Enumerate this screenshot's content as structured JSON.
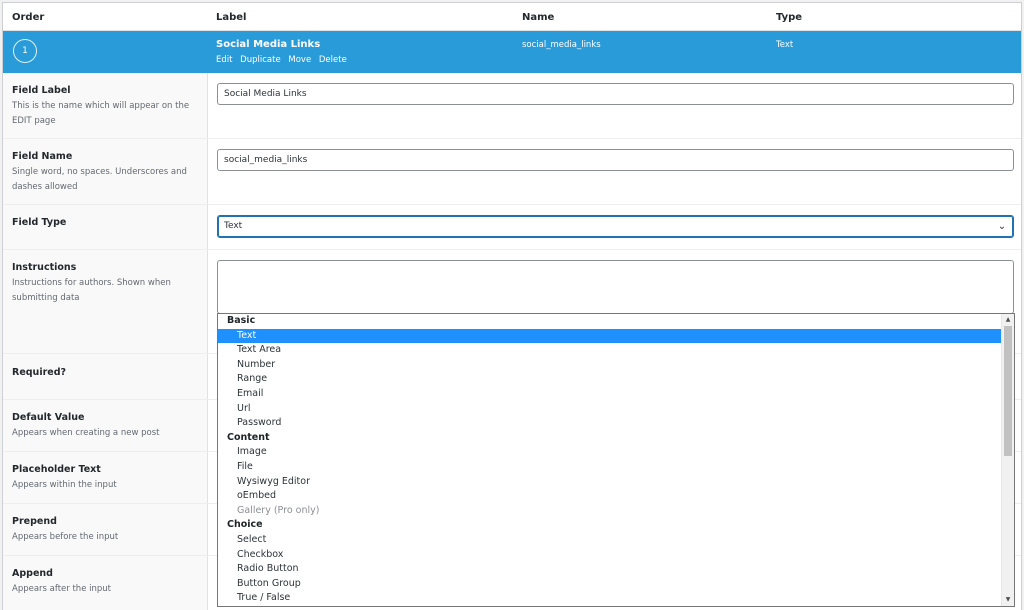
{
  "table_header": {
    "order": "Order",
    "label": "Label",
    "name": "Name",
    "type": "Type"
  },
  "field_row": {
    "order": "1",
    "label": "Social Media Links",
    "actions": [
      "Edit",
      "Duplicate",
      "Move",
      "Delete"
    ],
    "name": "social_media_links",
    "type": "Text"
  },
  "settings": {
    "field_label": {
      "title": "Field Label",
      "desc": "This is the name which will appear on the EDIT page",
      "value": "Social Media Links"
    },
    "field_name": {
      "title": "Field Name",
      "desc": "Single word, no spaces. Underscores and dashes allowed",
      "value": "social_media_links"
    },
    "field_type": {
      "title": "Field Type",
      "value": "Text"
    },
    "instructions": {
      "title": "Instructions",
      "desc": "Instructions for authors. Shown when submitting data",
      "value": ""
    },
    "required": {
      "title": "Required?"
    },
    "default_value": {
      "title": "Default Value",
      "desc": "Appears when creating a new post"
    },
    "placeholder_text": {
      "title": "Placeholder Text",
      "desc": "Appears within the input"
    },
    "prepend": {
      "title": "Prepend",
      "desc": "Appears before the input"
    },
    "append": {
      "title": "Append",
      "desc": "Appears after the input"
    }
  },
  "dropdown": {
    "groups": [
      {
        "label": "Basic",
        "options": [
          {
            "label": "Text",
            "selected": true
          },
          {
            "label": "Text Area"
          },
          {
            "label": "Number"
          },
          {
            "label": "Range"
          },
          {
            "label": "Email"
          },
          {
            "label": "Url"
          },
          {
            "label": "Password"
          }
        ]
      },
      {
        "label": "Content",
        "options": [
          {
            "label": "Image"
          },
          {
            "label": "File"
          },
          {
            "label": "Wysiwyg Editor"
          },
          {
            "label": "oEmbed"
          },
          {
            "label": "Gallery (Pro only)",
            "disabled": true
          }
        ]
      },
      {
        "label": "Choice",
        "options": [
          {
            "label": "Select"
          },
          {
            "label": "Checkbox"
          },
          {
            "label": "Radio Button"
          },
          {
            "label": "Button Group"
          },
          {
            "label": "True / False"
          }
        ]
      }
    ]
  },
  "colors": {
    "accent": "#2a9bd9",
    "selected_option": "#1e90ff",
    "focus_border": "#2271b1"
  }
}
